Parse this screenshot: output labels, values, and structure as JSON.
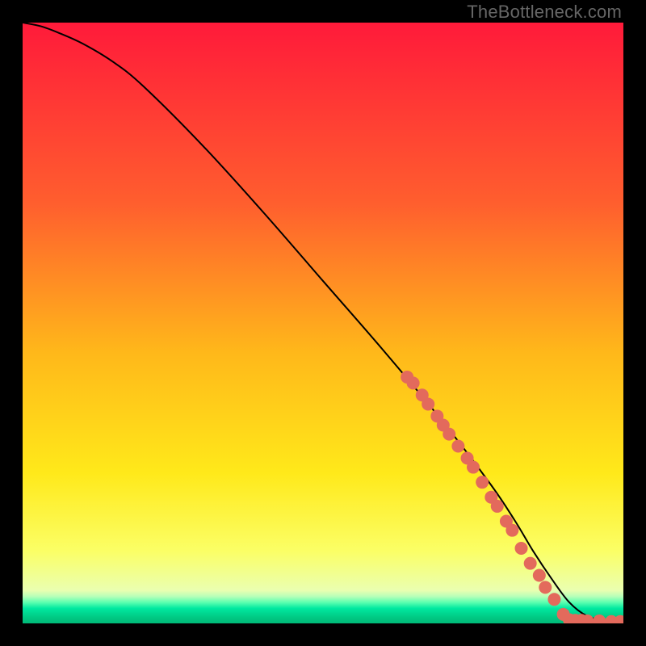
{
  "watermark": "TheBottleneck.com",
  "colors": {
    "frame": "#000000",
    "curve": "#000000",
    "point": "#e36a5c",
    "gradient_stops": [
      {
        "offset": 0.0,
        "color": "#ff1a3a"
      },
      {
        "offset": 0.3,
        "color": "#ff5e2e"
      },
      {
        "offset": 0.55,
        "color": "#ffb81a"
      },
      {
        "offset": 0.75,
        "color": "#ffe91a"
      },
      {
        "offset": 0.88,
        "color": "#fbff66"
      },
      {
        "offset": 0.945,
        "color": "#eaffb0"
      },
      {
        "offset": 0.955,
        "color": "#b8ffb8"
      },
      {
        "offset": 0.965,
        "color": "#5cffb0"
      },
      {
        "offset": 0.975,
        "color": "#00e8a0"
      },
      {
        "offset": 0.99,
        "color": "#00c983"
      },
      {
        "offset": 1.0,
        "color": "#00b877"
      }
    ]
  },
  "chart_data": {
    "type": "line",
    "title": "",
    "xlabel": "",
    "ylabel": "",
    "xlim": [
      0,
      100
    ],
    "ylim": [
      0,
      100
    ],
    "series": [
      {
        "name": "curve",
        "x": [
          0,
          3,
          6,
          10,
          15,
          20,
          30,
          40,
          50,
          60,
          70,
          78,
          82,
          85,
          88,
          91,
          94,
          97,
          100
        ],
        "y": [
          100,
          99.4,
          98.3,
          96.5,
          93.5,
          89.5,
          79.5,
          68.5,
          57.0,
          45.5,
          33.5,
          23.0,
          17.0,
          12.0,
          7.5,
          3.5,
          1.2,
          0.5,
          0.3
        ]
      }
    ],
    "points": [
      {
        "x": 64,
        "y": 41
      },
      {
        "x": 65,
        "y": 40
      },
      {
        "x": 66.5,
        "y": 38
      },
      {
        "x": 67.5,
        "y": 36.5
      },
      {
        "x": 69,
        "y": 34.5
      },
      {
        "x": 70,
        "y": 33
      },
      {
        "x": 71,
        "y": 31.5
      },
      {
        "x": 72.5,
        "y": 29.5
      },
      {
        "x": 74,
        "y": 27.5
      },
      {
        "x": 75,
        "y": 26
      },
      {
        "x": 76.5,
        "y": 23.5
      },
      {
        "x": 78,
        "y": 21
      },
      {
        "x": 79,
        "y": 19.5
      },
      {
        "x": 80.5,
        "y": 17
      },
      {
        "x": 81.5,
        "y": 15.5
      },
      {
        "x": 83,
        "y": 12.5
      },
      {
        "x": 84.5,
        "y": 10
      },
      {
        "x": 86,
        "y": 8
      },
      {
        "x": 87,
        "y": 6
      },
      {
        "x": 88.5,
        "y": 4
      },
      {
        "x": 90,
        "y": 1.5
      },
      {
        "x": 91,
        "y": 0.6
      },
      {
        "x": 92,
        "y": 0.5
      },
      {
        "x": 93,
        "y": 0.5
      },
      {
        "x": 94,
        "y": 0.4
      },
      {
        "x": 96,
        "y": 0.4
      },
      {
        "x": 98,
        "y": 0.3
      },
      {
        "x": 99.5,
        "y": 0.3
      }
    ]
  }
}
